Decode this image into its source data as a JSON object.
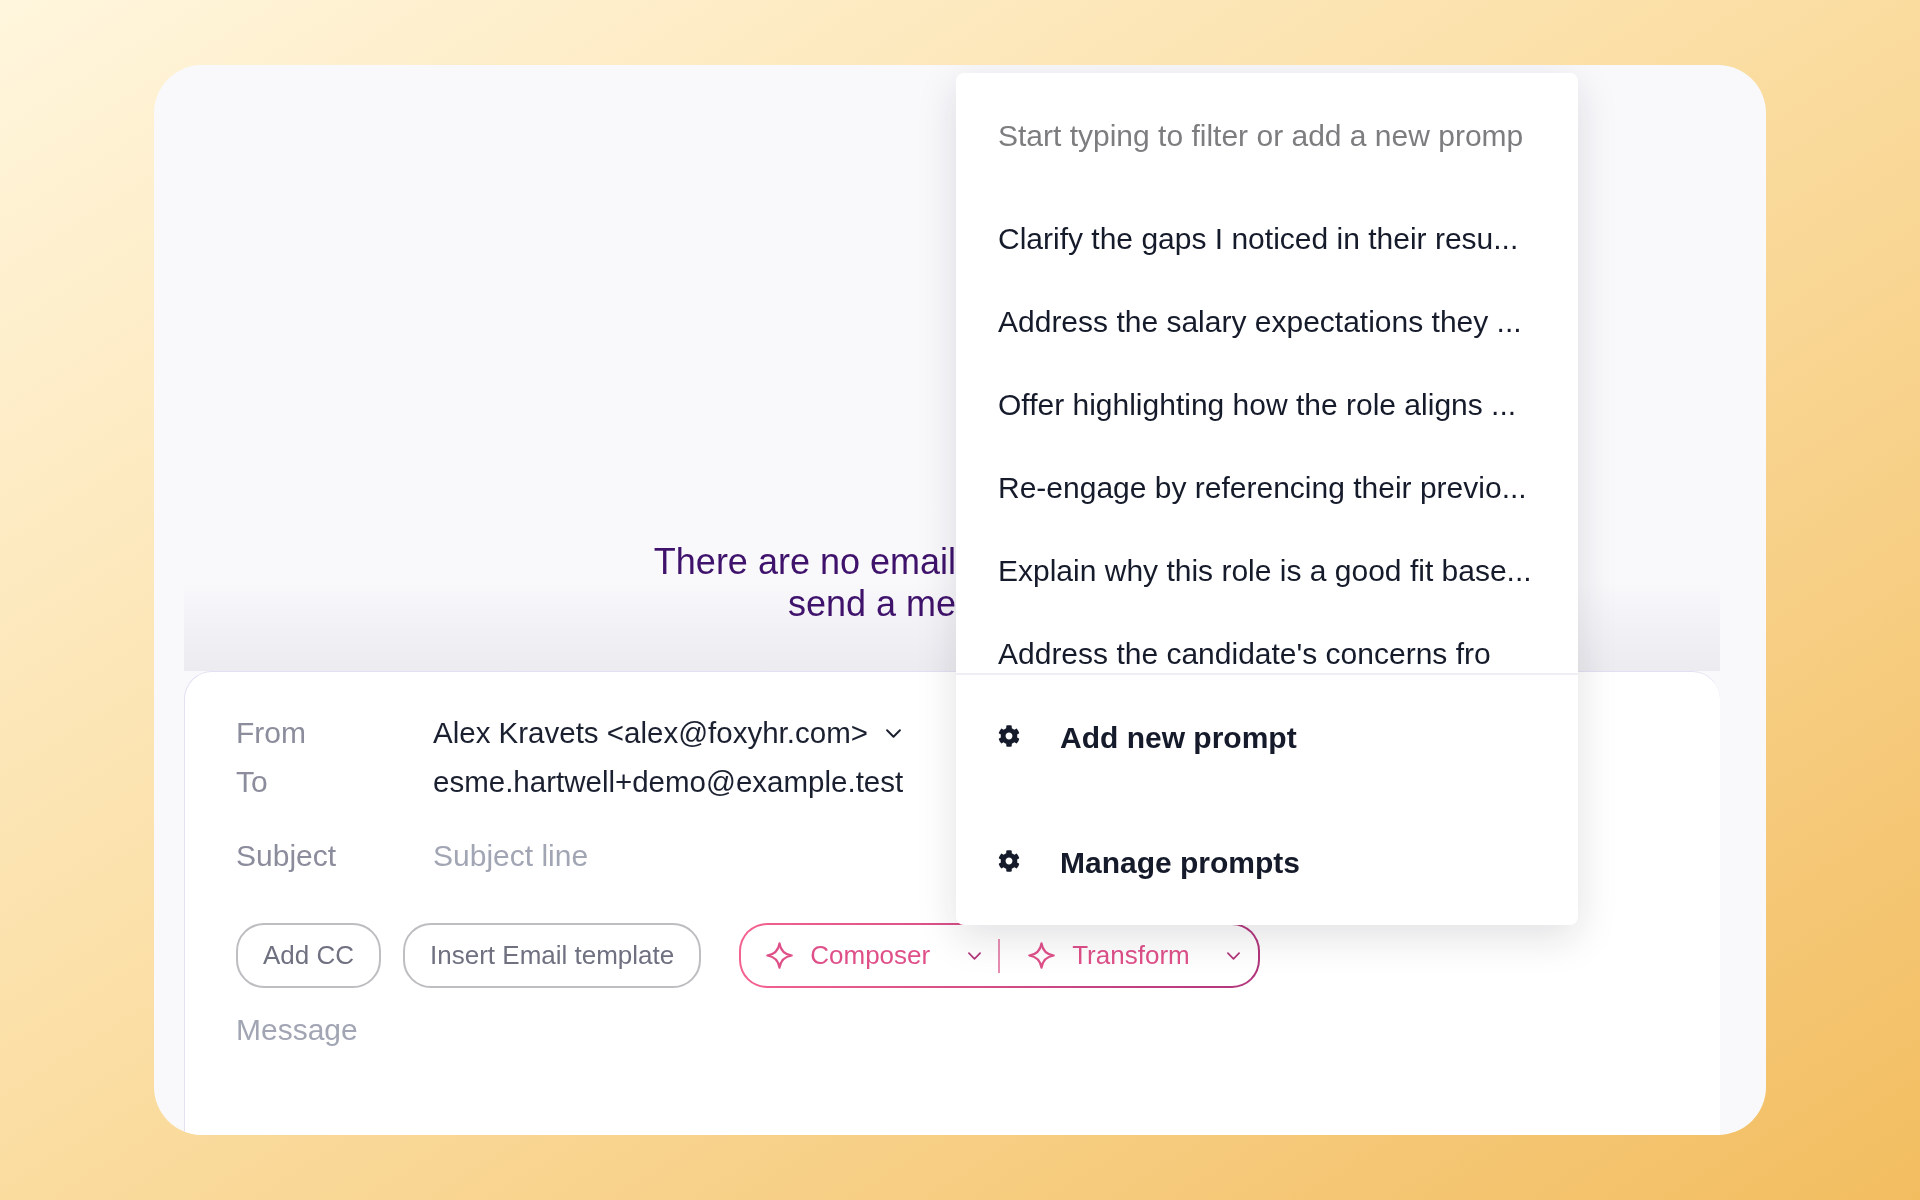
{
  "empty_state": {
    "lines": [
      "There are no email",
      "send a me"
    ]
  },
  "prompt_menu": {
    "search": {
      "placeholder": "Start typing to filter or add a new promp"
    },
    "prompts": [
      "Clarify the gaps I noticed in their resu...",
      "Address the salary expectations they ...",
      "Offer highlighting how the role aligns ...",
      "Re-engage by referencing their previo...",
      "Explain why this role is a good fit base...",
      "Address the candidate's concerns fro"
    ],
    "actions": [
      {
        "label": "Add new prompt"
      },
      {
        "label": "Manage prompts"
      }
    ]
  },
  "compose": {
    "fields": [
      {
        "label": "From",
        "kind": "select",
        "value": "Alex Kravets <alex@foxyhr.com>"
      },
      {
        "label": "To",
        "kind": "text",
        "value": "esme.hartwell+demo@example.test"
      },
      {
        "label": "Subject",
        "kind": "input",
        "placeholder": "Subject line"
      }
    ],
    "buttons": [
      "Add CC",
      "Insert Email template"
    ],
    "ai_buttons": [
      {
        "label": "Composer"
      },
      {
        "label": "Transform"
      }
    ],
    "message": {
      "placeholder": "Message"
    }
  }
}
